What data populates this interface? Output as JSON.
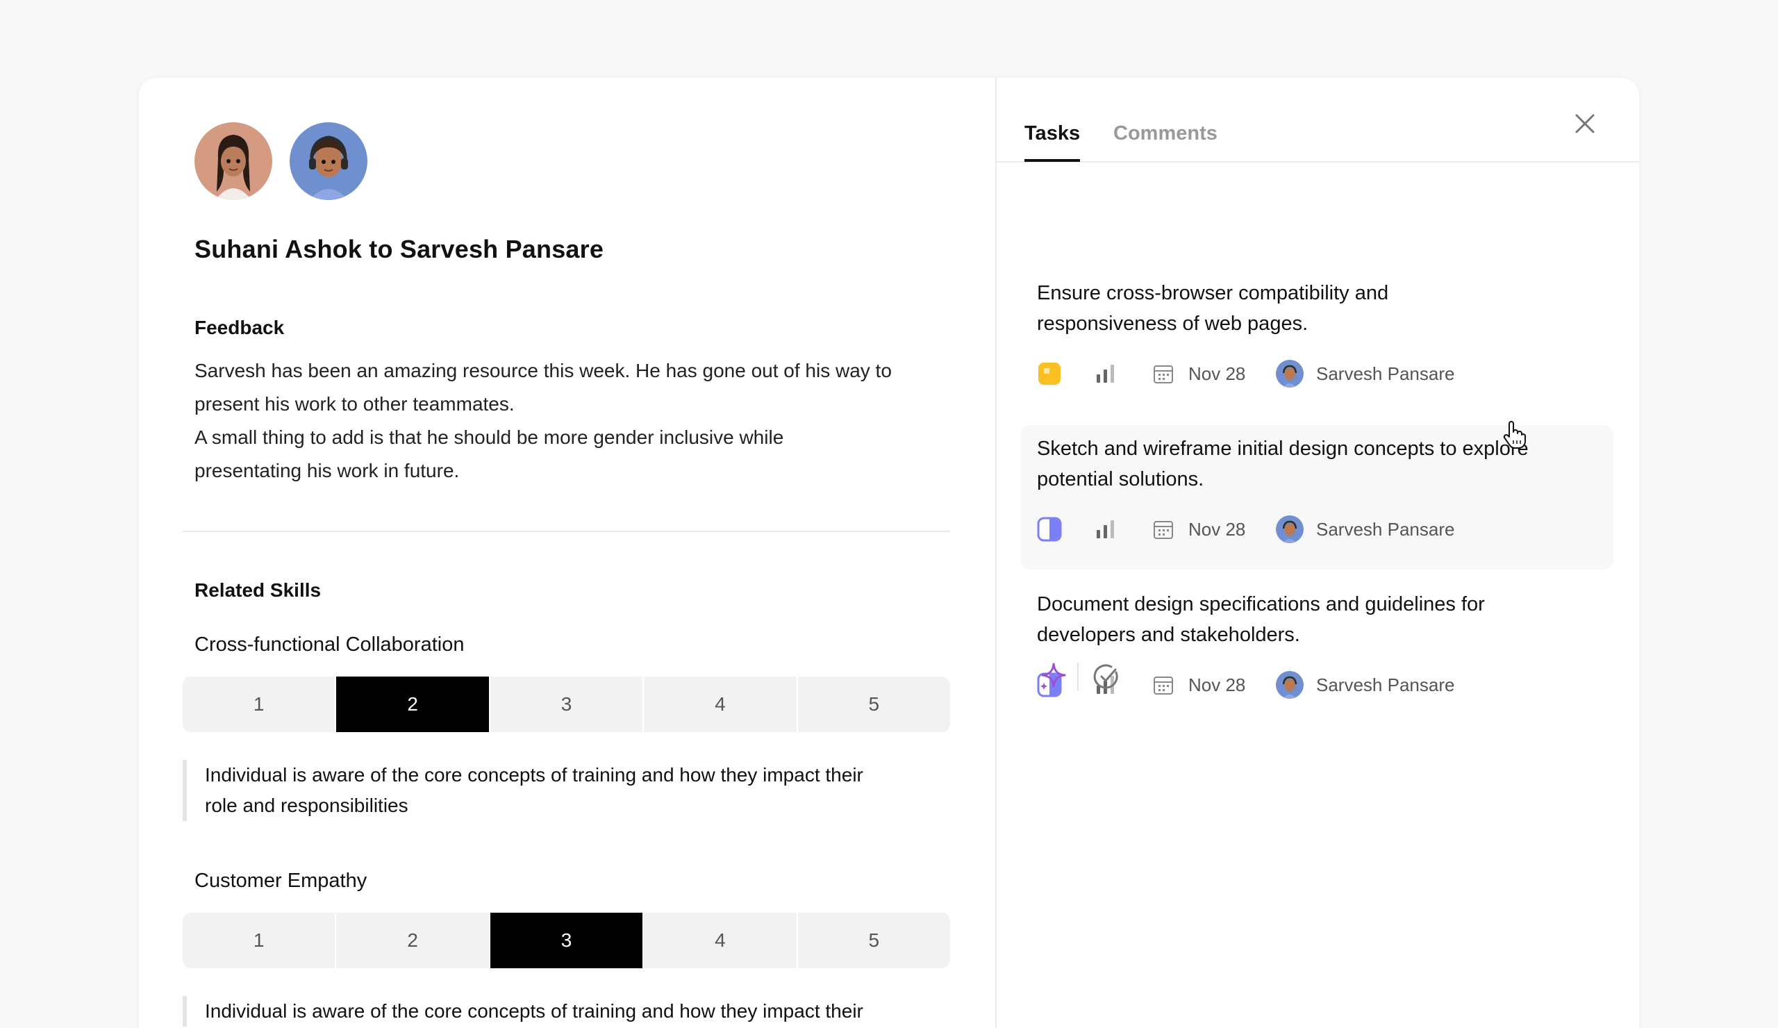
{
  "header": {
    "title": "Suhani Ashok to Sarvesh Pansare",
    "avatars": [
      {
        "name": "suhani-avatar",
        "bg": "#d59a82"
      },
      {
        "name": "sarvesh-avatar",
        "bg": "#6f8fcf"
      }
    ]
  },
  "feedback": {
    "label": "Feedback",
    "lines": [
      "Sarvesh has been an amazing resource this week. He has gone out of his way to",
      "present his work to other teammates.",
      "A small thing to add is that he should be more gender inclusive while",
      "presentating his work in future."
    ]
  },
  "related_skills": {
    "label": "Related Skills",
    "skills": [
      {
        "name": "Cross-functional Collaboration",
        "options": [
          "1",
          "2",
          "3",
          "4",
          "5"
        ],
        "selected": "2",
        "description_lines": [
          "Individual is aware of the core concepts of training and how they impact their",
          "role and responsibilities"
        ]
      },
      {
        "name": "Customer Empathy",
        "options": [
          "1",
          "2",
          "3",
          "4",
          "5"
        ],
        "selected": "3",
        "description_lines": [
          "Individual is aware of the core concepts of training and how they impact their"
        ]
      }
    ]
  },
  "tabs": [
    {
      "label": "Tasks",
      "active": true
    },
    {
      "label": "Comments",
      "active": false
    }
  ],
  "tasks": [
    {
      "title_lines": [
        "Ensure cross-browser compatibility and",
        "responsiveness of web pages."
      ],
      "status_icon": "status-yellow-icon",
      "status_color": "#fbbf24",
      "priority_icon": "priority-bars-icon",
      "date": "Nov 28",
      "assignee": "Sarvesh Pansare",
      "hover": false
    },
    {
      "title_lines": [
        "Sketch and wireframe initial design concepts to explore",
        "potential solutions."
      ],
      "status_icon": "status-half-icon",
      "status_color": "#7b7ff5",
      "priority_icon": "priority-bars-icon",
      "date": "Nov 28",
      "assignee": "Sarvesh Pansare",
      "hover": true
    },
    {
      "title_lines": [
        "Document design specifications and guidelines for",
        "developers and stakeholders."
      ],
      "status_icon": "status-half-icon",
      "status_color": "#7b7ff5",
      "priority_icon": "priority-bars-icon",
      "date": "Nov 28",
      "assignee": "Sarvesh Pansare",
      "hover": false
    }
  ],
  "actions": [
    {
      "icon": "sparkle-icon",
      "color": "#9b4fd9"
    },
    {
      "icon": "check-circle-icon",
      "color": "#777777"
    }
  ],
  "colors": {
    "accent_active": "#000000",
    "segment_bg": "#f2f2f2"
  }
}
